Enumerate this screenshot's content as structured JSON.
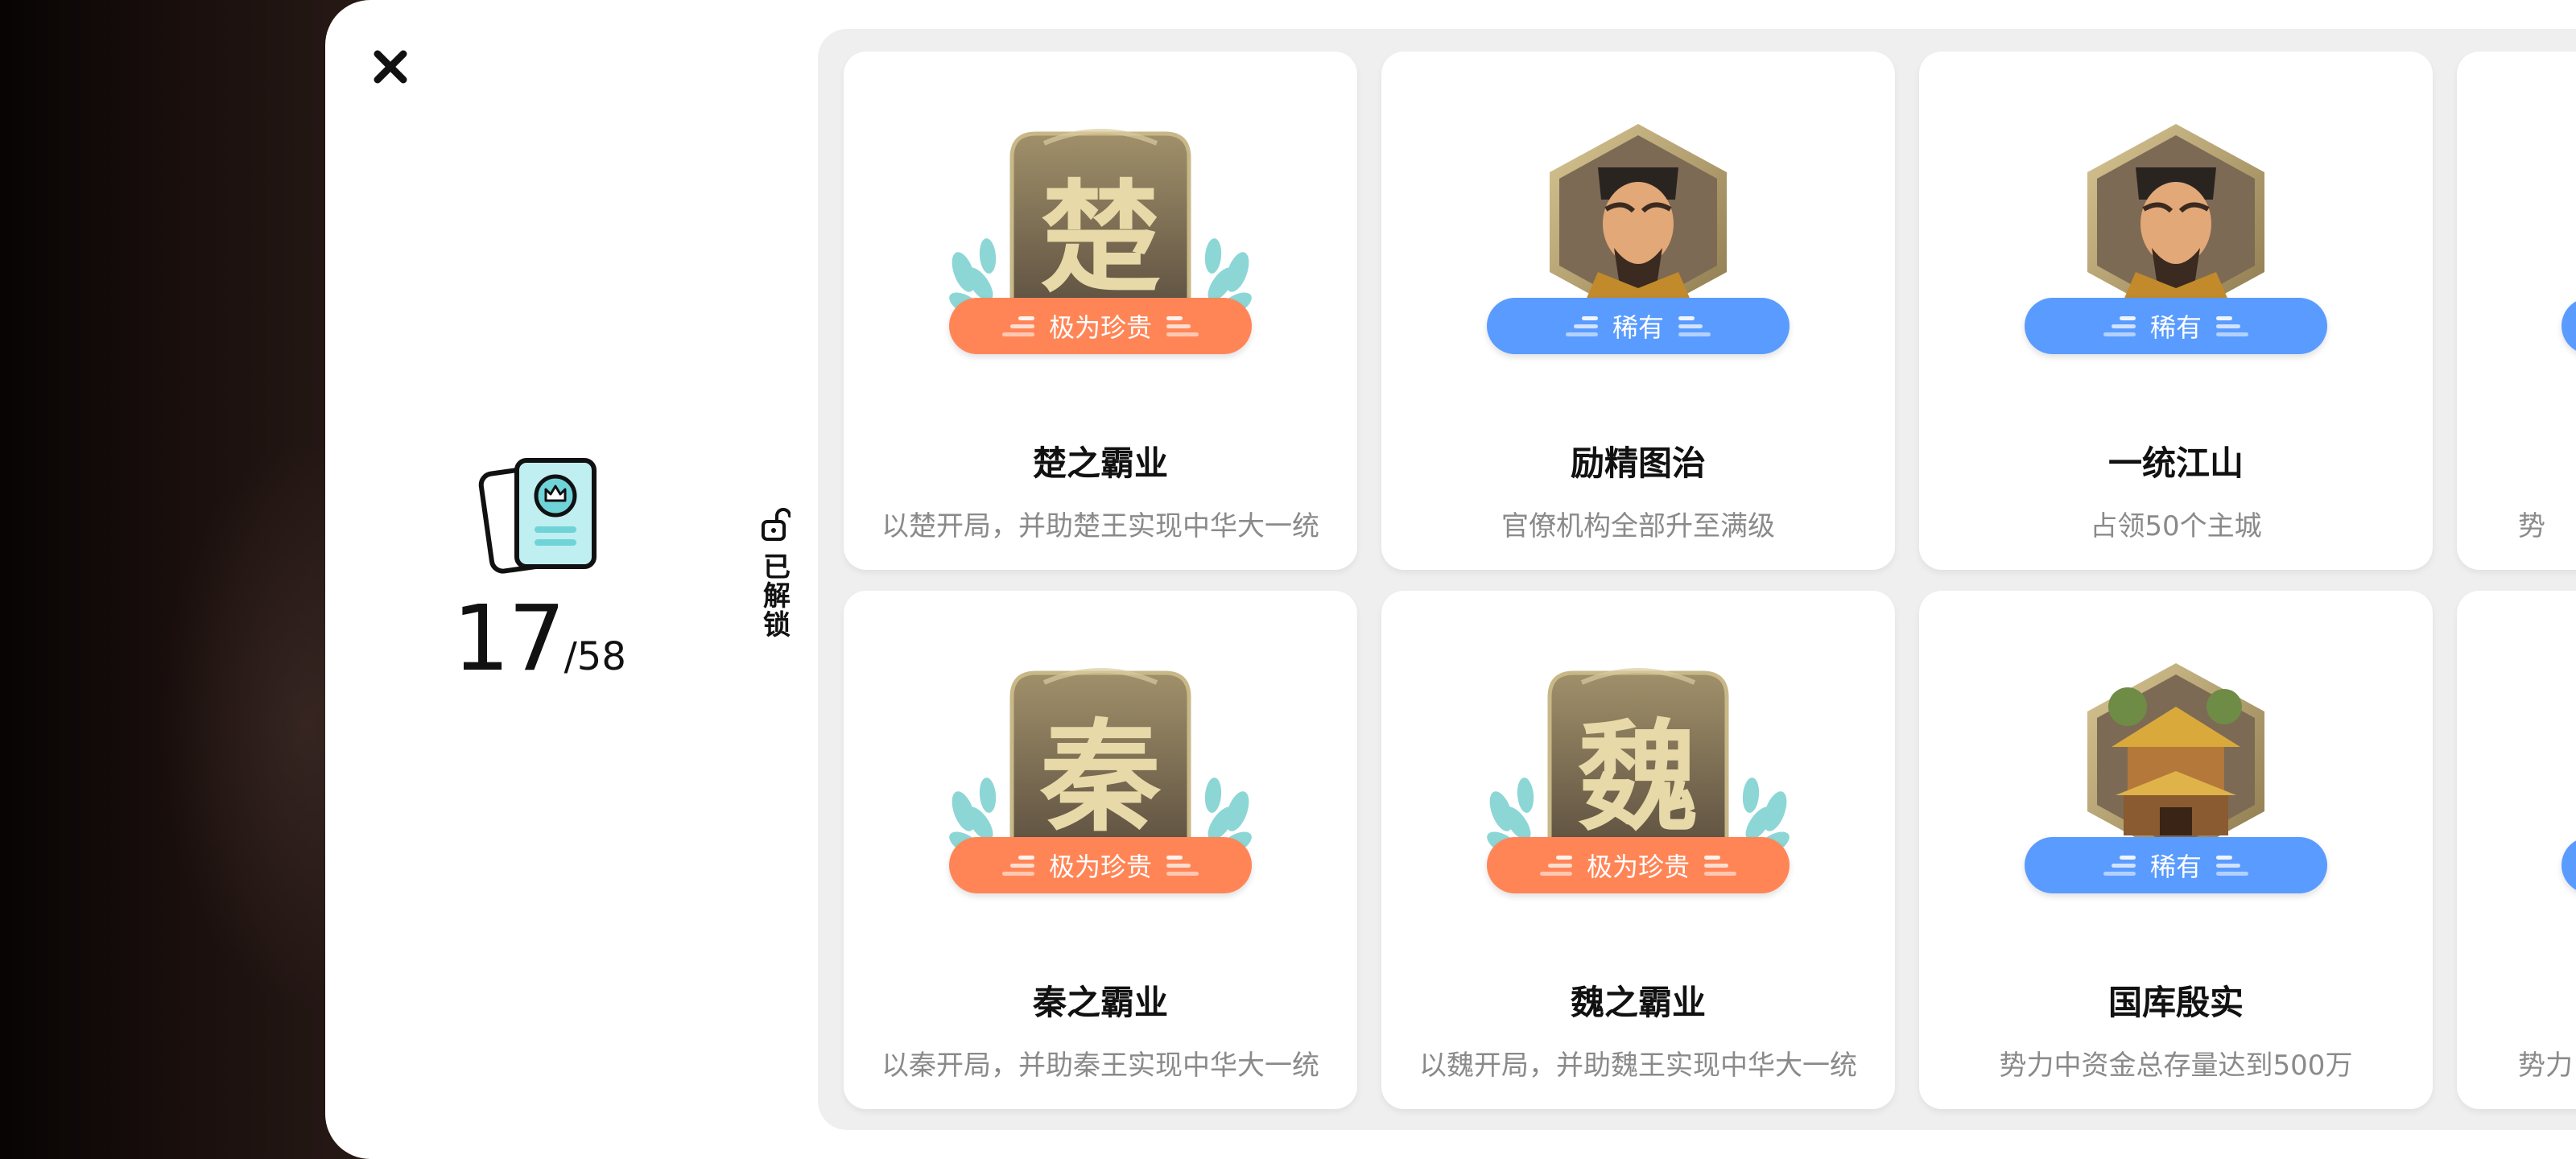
{
  "summary": {
    "unlocked": "17",
    "total": "/58"
  },
  "tab": {
    "unlocked_label": "已解锁"
  },
  "colors": {
    "precious": "#ff8557",
    "rare": "#5a9bff",
    "laurel": "#8dd6d6"
  },
  "achievements": [
    {
      "title": "楚之霸业",
      "desc": "以楚开局，并助楚王实现中华大一统",
      "rarity": "极为珍贵",
      "emblem": "seal",
      "glyph": "楚"
    },
    {
      "title": "励精图治",
      "desc": "官僚机构全部升至满级",
      "rarity": "稀有",
      "emblem": "portrait"
    },
    {
      "title": "一统江山",
      "desc": "占领50个主城",
      "rarity": "稀有",
      "emblem": "portrait"
    },
    {
      "title": "",
      "desc": "势",
      "rarity": "",
      "emblem": "partial"
    },
    {
      "title": "秦之霸业",
      "desc": "以秦开局，并助秦王实现中华大一统",
      "rarity": "极为珍贵",
      "emblem": "seal",
      "glyph": "秦"
    },
    {
      "title": "魏之霸业",
      "desc": "以魏开局，并助魏王实现中华大一统",
      "rarity": "极为珍贵",
      "emblem": "seal",
      "glyph": "魏"
    },
    {
      "title": "国库殷实",
      "desc": "势力中资金总存量达到500万",
      "rarity": "稀有",
      "emblem": "building"
    },
    {
      "title": "",
      "desc": "势力",
      "rarity": "",
      "emblem": "partial"
    }
  ]
}
